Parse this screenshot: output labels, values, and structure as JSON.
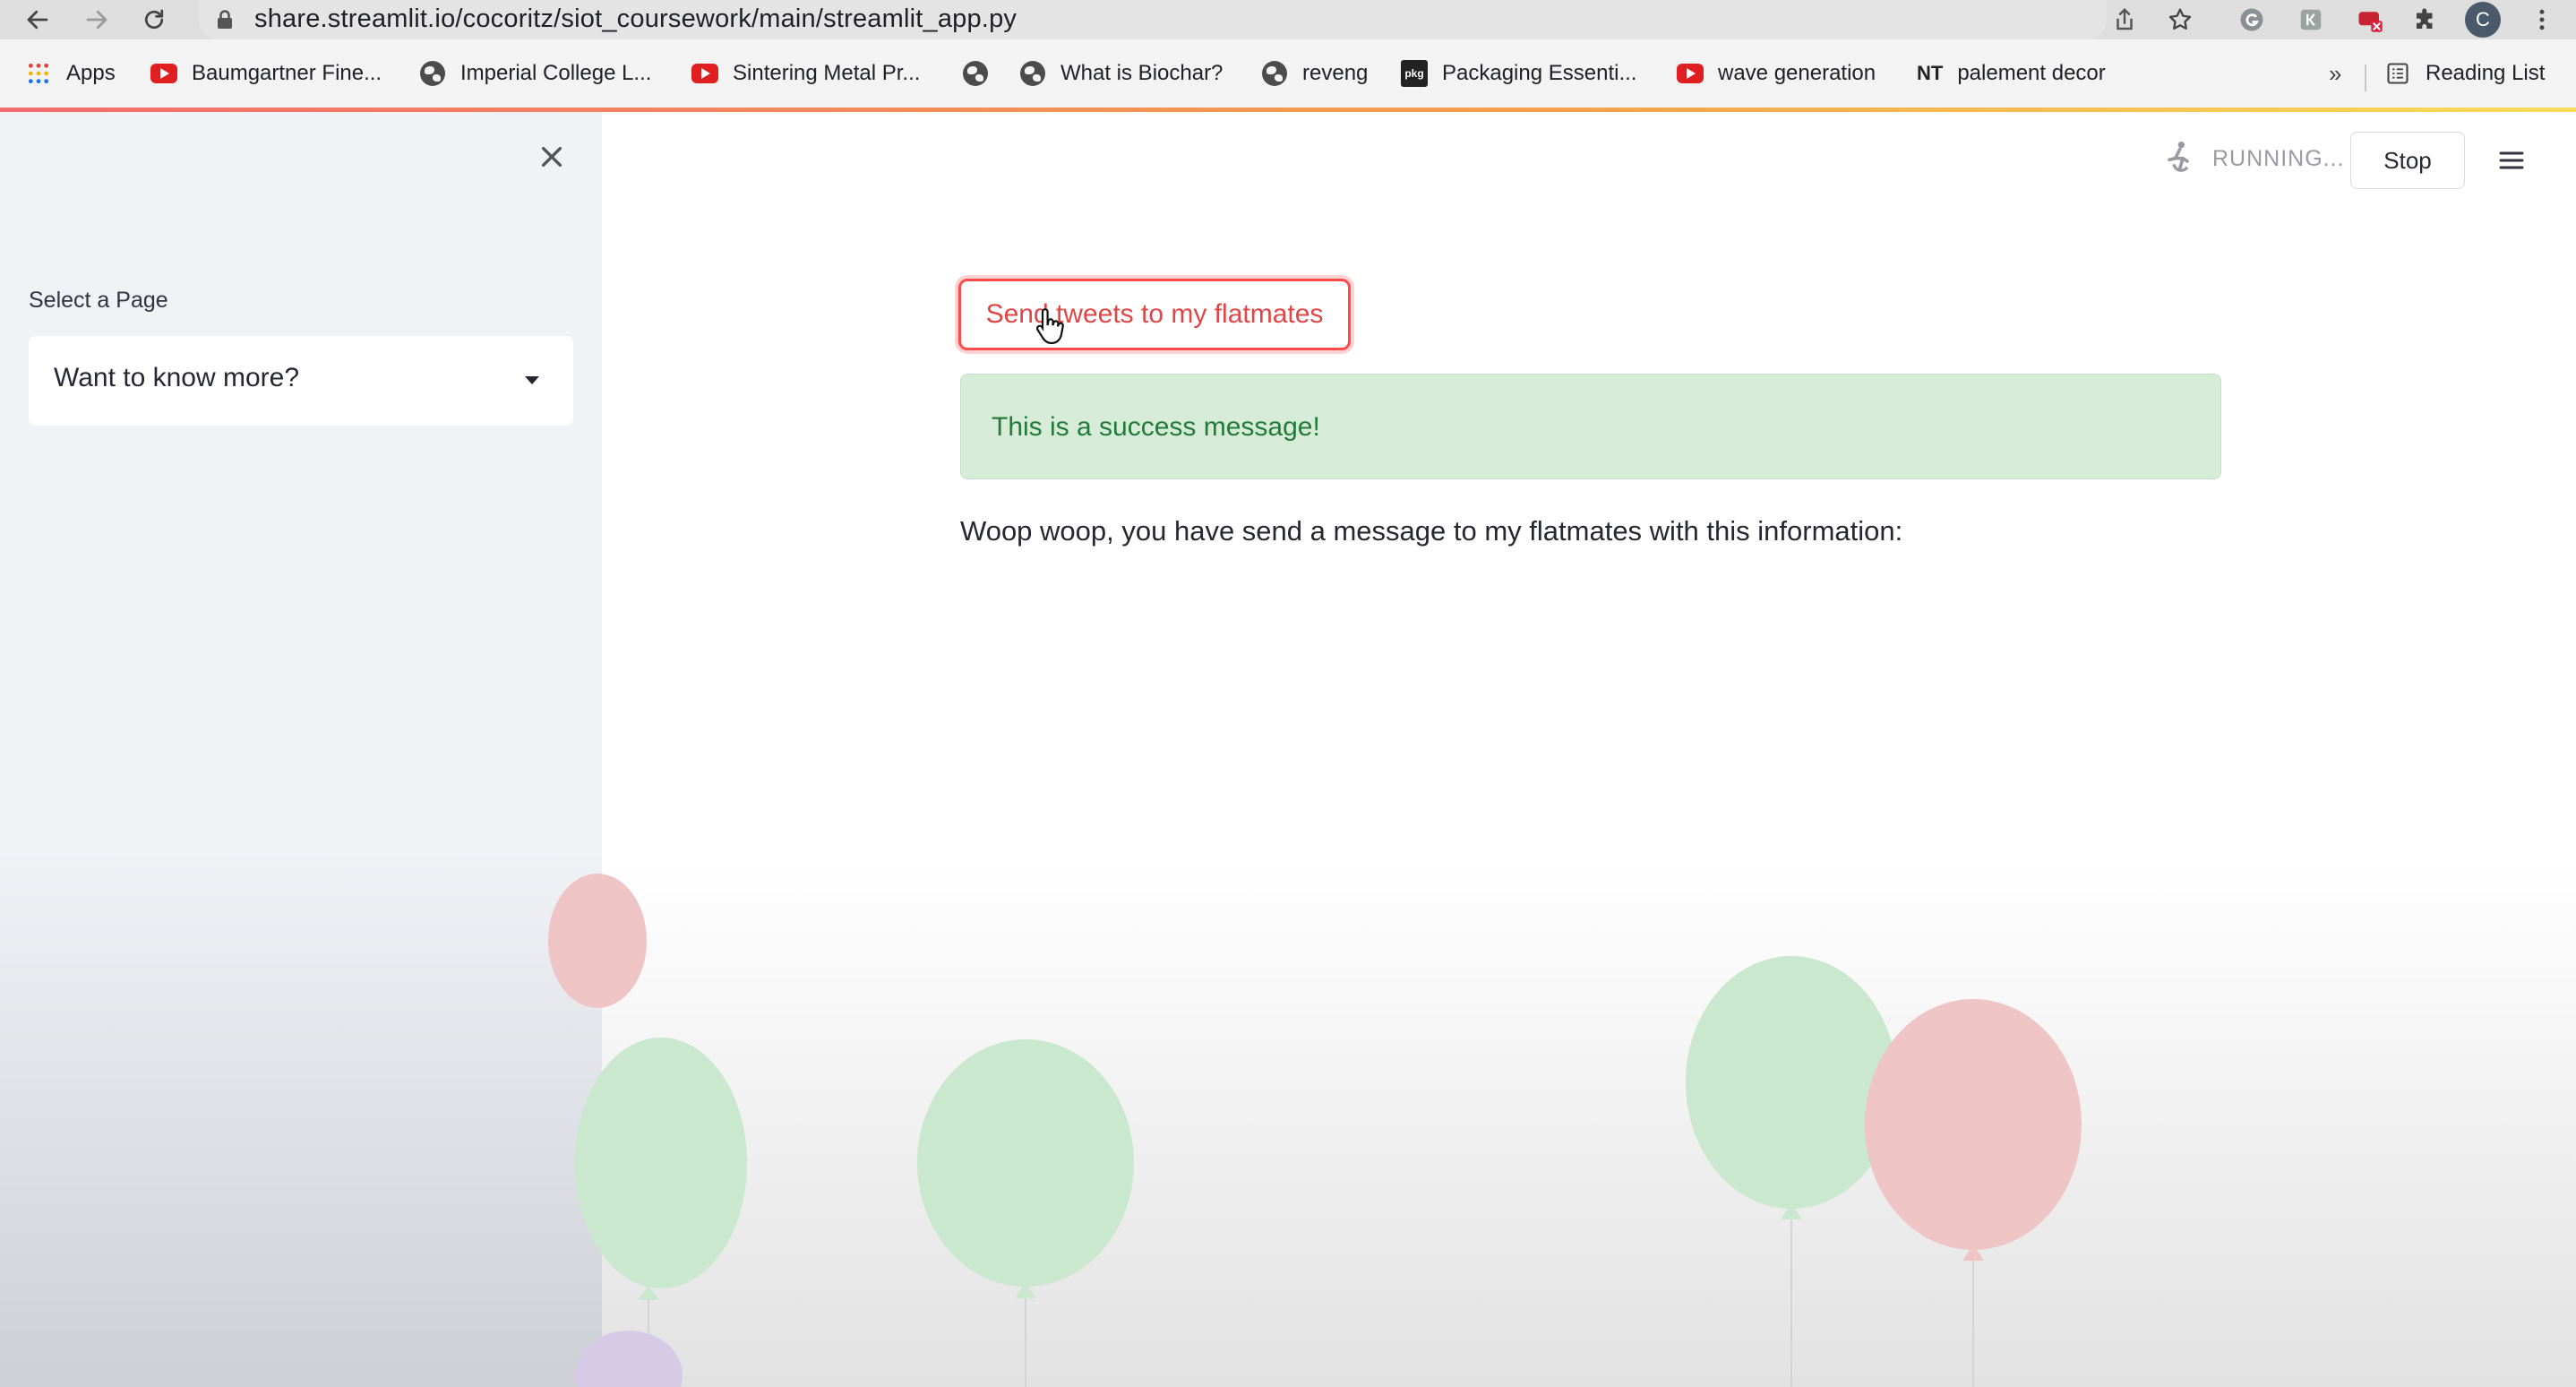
{
  "browser": {
    "url": "share.streamlit.io/cocoritz/siot_coursework/main/streamlit_app.py",
    "avatar_initial": "C",
    "bookmarks": [
      {
        "label": "Apps",
        "icon": "apps-grid-icon"
      },
      {
        "label": "Baumgartner Fine...",
        "icon": "youtube-icon"
      },
      {
        "label": "Imperial College L...",
        "icon": "globe-icon"
      },
      {
        "label": "Sintering Metal Pr...",
        "icon": "youtube-icon"
      },
      {
        "label": "",
        "icon": "globe-icon"
      },
      {
        "label": "What is Biochar?",
        "icon": "globe-icon"
      },
      {
        "label": "reveng",
        "icon": "globe-icon"
      },
      {
        "label": "Packaging Essenti...",
        "icon": "packaging-icon"
      },
      {
        "label": "wave generation",
        "icon": "youtube-icon"
      },
      {
        "label": "palement decor",
        "icon_text": "NT"
      }
    ],
    "overflow": "»",
    "reading_list": "Reading List"
  },
  "sidebar": {
    "select_label": "Select a Page",
    "select_value": "Want to know more?"
  },
  "header": {
    "status": "RUNNING...",
    "stop_label": "Stop"
  },
  "main": {
    "send_button_label": "Send tweets to my flatmates",
    "success_message": "This is a success message!",
    "info_text": "Woop woop, you have send a message to my flatmates with this information:"
  },
  "colors": {
    "primary": "#ff4b4b",
    "success_bg": "#d6ecd9",
    "success_text": "#227b37",
    "sidebar_bg": "#f0f2f6",
    "balloon_green": "#c9e8cd",
    "balloon_red": "#efc4c4",
    "balloon_purple": "#d6cbe6"
  }
}
